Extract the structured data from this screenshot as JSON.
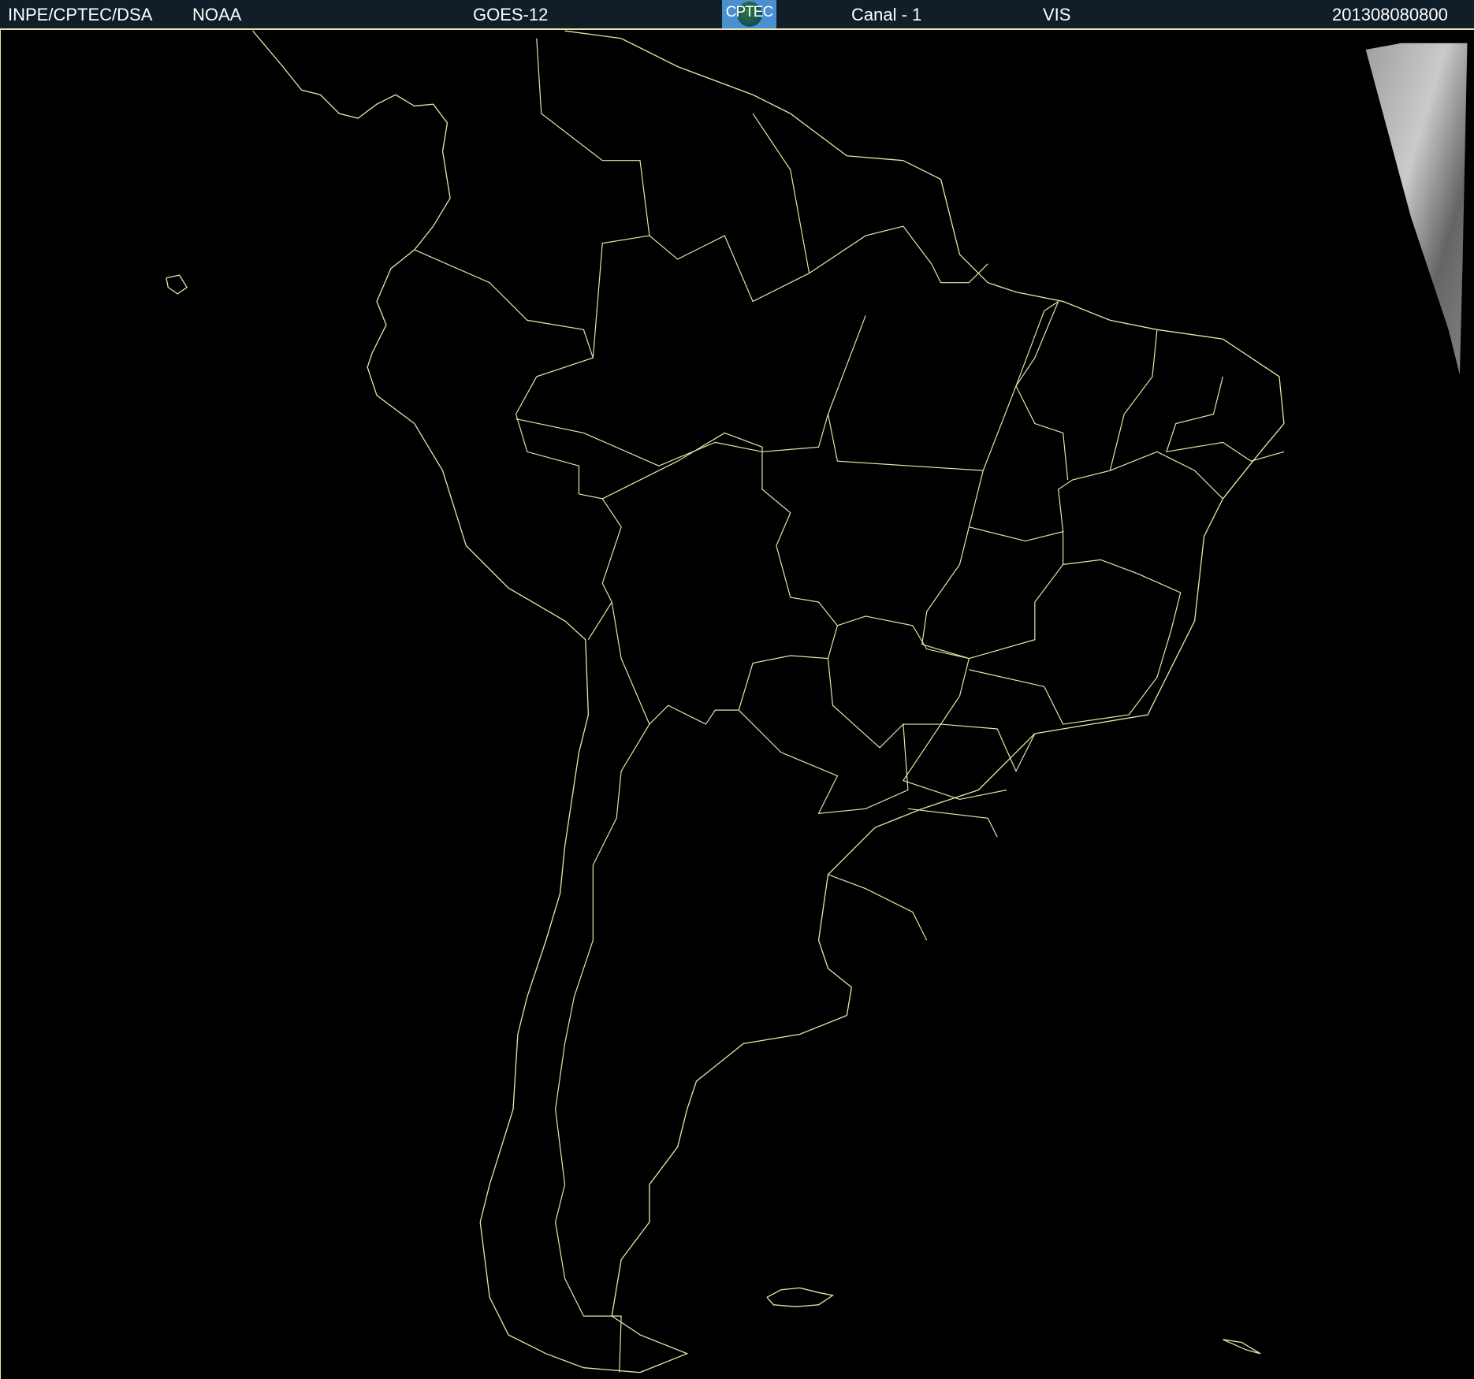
{
  "header": {
    "org": "INPE/CPTEC/DSA",
    "agency": "NOAA",
    "satellite": "GOES-12",
    "logo_text": "CPTEC",
    "channel": "Canal - 1",
    "band": "VIS",
    "timestamp": "201308080800"
  },
  "colors": {
    "header_bg": "#111d27",
    "outline": "#e8e6a8",
    "background": "#000000"
  }
}
